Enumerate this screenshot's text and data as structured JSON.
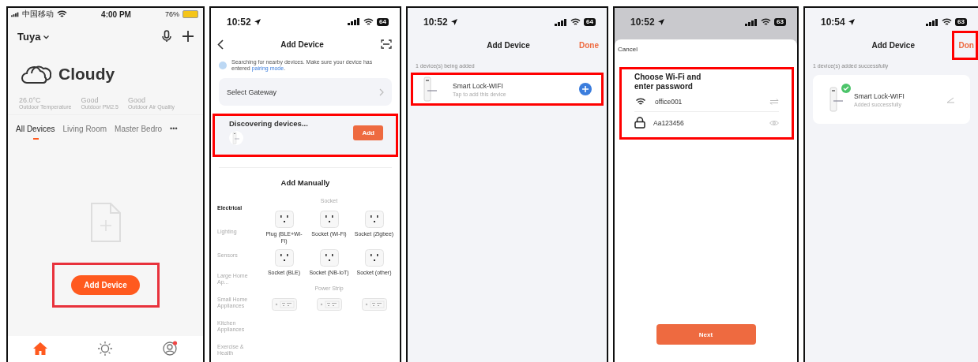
{
  "screens": [
    {
      "kind": "home",
      "status": {
        "carrier": "中国移动",
        "time": "4:00 PM",
        "battery": "76%"
      },
      "home_name": "Tuya",
      "weather": "Cloudy",
      "stats": [
        {
          "value": "26.0°C",
          "label": "Outdoor Temperature"
        },
        {
          "value": "Good",
          "label": "Outdoor PM2.5"
        },
        {
          "value": "Good",
          "label": "Outdoor Air Quality"
        }
      ],
      "rooms": [
        {
          "label": "All Devices",
          "selected": true
        },
        {
          "label": "Living Room",
          "selected": false
        },
        {
          "label": "Master Bedro",
          "selected": false
        }
      ],
      "more": "•••",
      "add_button": {
        "label": "Add Device",
        "highlighted": true
      },
      "tabs": [
        {
          "selected": true
        },
        {
          "selected": false
        },
        {
          "selected": false
        }
      ]
    },
    {
      "kind": "add_device",
      "status": {
        "time": "10:52",
        "battery": "64"
      },
      "title": "Add Device",
      "notice": "Searching for nearby devices. Make sure your device has entered ",
      "notice_link": "pairing mode",
      "notice_end": ".",
      "gateway": "Select Gateway",
      "discovering": {
        "title": "Discovering devices...",
        "button": "Add",
        "highlighted": true
      },
      "manual_title": "Add Manually",
      "categories": [
        {
          "label": "Electrical",
          "selected": true
        },
        {
          "label": "Lighting",
          "selected": false
        },
        {
          "label": "Sensors",
          "selected": false
        },
        {
          "label": "Large Home Ap...",
          "selected": false
        },
        {
          "label": "Small Home Appliances",
          "selected": false
        },
        {
          "label": "Kitchen Appliances",
          "selected": false
        },
        {
          "label": "Exercise & Health",
          "selected": false
        }
      ],
      "groups": [
        {
          "title": "Socket",
          "kind": "socket",
          "items": [
            "Plug (BLE+Wi-Fi)",
            "Socket (Wi-Fi)",
            "Socket (Zigbee)",
            "Socket (BLE)",
            "Socket (NB-IoT)",
            "Socket (other)"
          ]
        },
        {
          "title": "Power Strip",
          "kind": "strip"
        }
      ]
    },
    {
      "kind": "adding",
      "status": {
        "time": "10:52",
        "battery": "64"
      },
      "title": "Add Device",
      "done": {
        "label": "Done",
        "highlighted": false
      },
      "caption": "1 device(s) being added",
      "device": {
        "name": "Smart Lock-WIFI",
        "sub": "Tap to add this device",
        "added": false,
        "highlighted": true
      }
    },
    {
      "kind": "wifi",
      "status": {
        "time": "10:52",
        "battery": "63"
      },
      "cancel": "Cancel",
      "heading": "Choose Wi-Fi and enter password",
      "ssid": "office001",
      "password": "Aa123456",
      "highlighted": true,
      "next": "Next"
    },
    {
      "kind": "adding",
      "status": {
        "time": "10:54",
        "battery": "63"
      },
      "title": "Add Device",
      "done": {
        "label": "Don",
        "highlighted": true
      },
      "caption": "1 device(s) added successfully",
      "device": {
        "name": "Smart Lock-WIFI",
        "sub": "Added successfully",
        "added": true,
        "highlighted": false
      }
    }
  ]
}
